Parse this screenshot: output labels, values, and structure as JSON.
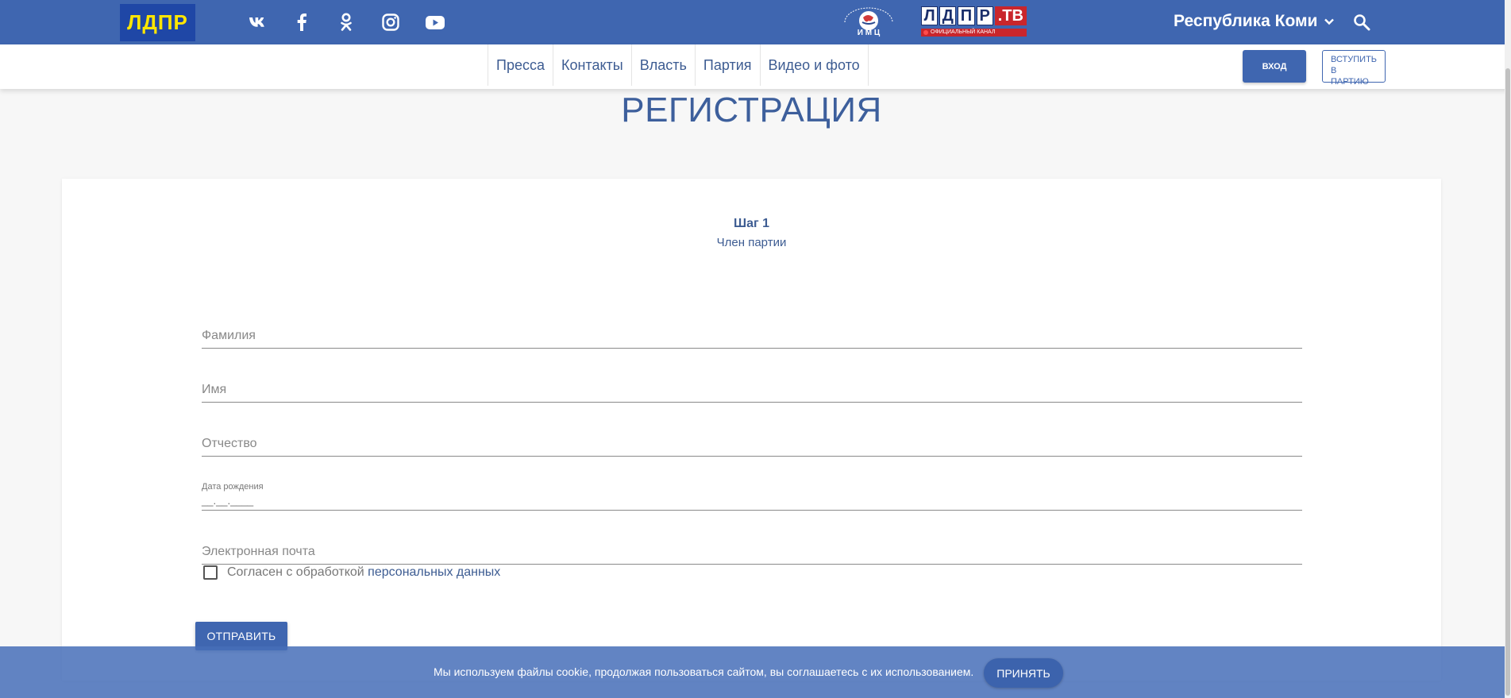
{
  "header": {
    "logo_text": "ЛДПР",
    "social_icons": [
      "vk-icon",
      "facebook-icon",
      "odnoklassniki-icon",
      "instagram-icon",
      "youtube-icon"
    ],
    "partner_imc_text": "И М Ц",
    "partner_tv": {
      "letters": [
        "Л",
        "Д",
        "П",
        "Р"
      ],
      "suffix": ".ТВ",
      "tagline": "ОФИЦИАЛЬНЫЙ КАНАЛ"
    },
    "region": "Республика Коми",
    "colors": {
      "bar": "#3f66b0",
      "logo_bg": "#1f47a6",
      "logo_text": "#ffe600"
    }
  },
  "nav": {
    "items": [
      "Пресса",
      "Контакты",
      "Власть",
      "Партия",
      "Видео и фото"
    ],
    "login_label": "ВХОД",
    "join_label": "ВСТУПИТЬ\nВ ПАРТИЮ"
  },
  "page": {
    "title": "РЕГИСТРАЦИЯ"
  },
  "form": {
    "step_title": "Шаг 1",
    "step_subtitle": "Член партии",
    "fields": {
      "last_name": {
        "placeholder": "Фамилия"
      },
      "first_name": {
        "placeholder": "Имя"
      },
      "middle_name": {
        "placeholder": "Отчество"
      },
      "birth_date": {
        "label": "Дата рождения",
        "value": "__.__.____"
      },
      "email": {
        "placeholder": "Электронная почта"
      }
    },
    "consent_text": "Согласен с обработкой ",
    "consent_link": "персональных данных",
    "submit_label": "ОТПРАВИТЬ"
  },
  "cookie": {
    "text": "Мы используем файлы cookie, продолжая пользоваться сайтом, вы соглашаетесь с их использованием.",
    "accept_label": "ПРИНЯТЬ"
  }
}
